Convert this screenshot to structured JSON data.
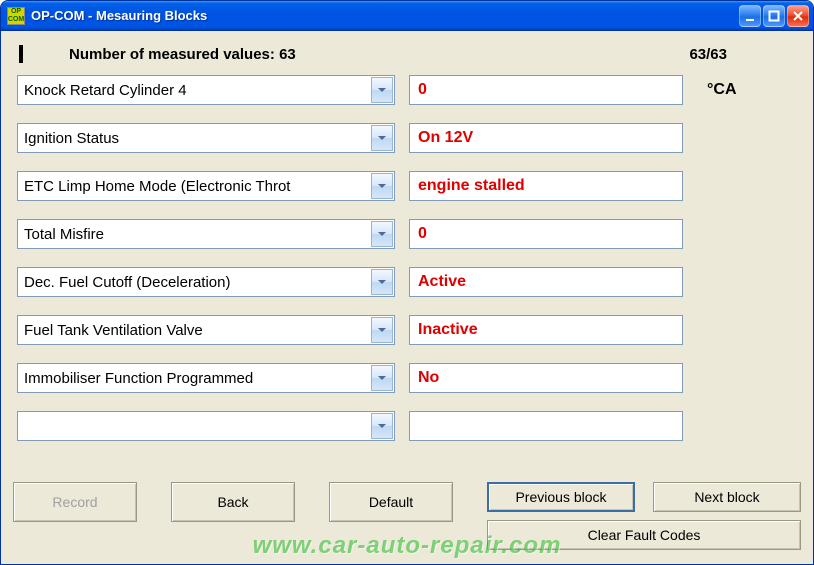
{
  "window": {
    "title": "OP-COM - Mesauring Blocks",
    "app_icon_text": "OP COM"
  },
  "header": {
    "label": "Number of measured values: 63",
    "counter": "63/63"
  },
  "rows": [
    {
      "param": "Knock Retard Cylinder 4",
      "value": "0",
      "unit": "°CA"
    },
    {
      "param": "Ignition Status",
      "value": "On  12V",
      "unit": ""
    },
    {
      "param": "ETC Limp Home Mode (Electronic Throt",
      "value": "engine stalled",
      "unit": ""
    },
    {
      "param": "Total Misfire",
      "value": "0",
      "unit": ""
    },
    {
      "param": "Dec. Fuel Cutoff (Deceleration)",
      "value": "Active",
      "unit": ""
    },
    {
      "param": "Fuel Tank Ventilation Valve",
      "value": "Inactive",
      "unit": ""
    },
    {
      "param": "Immobiliser Function Programmed",
      "value": "No",
      "unit": ""
    },
    {
      "param": "",
      "value": "",
      "unit": ""
    }
  ],
  "buttons": {
    "record": "Record",
    "back": "Back",
    "default": "Default",
    "previous": "Previous block",
    "next": "Next block",
    "clear": "Clear Fault Codes"
  },
  "watermark": "www.car-auto-repair.com"
}
